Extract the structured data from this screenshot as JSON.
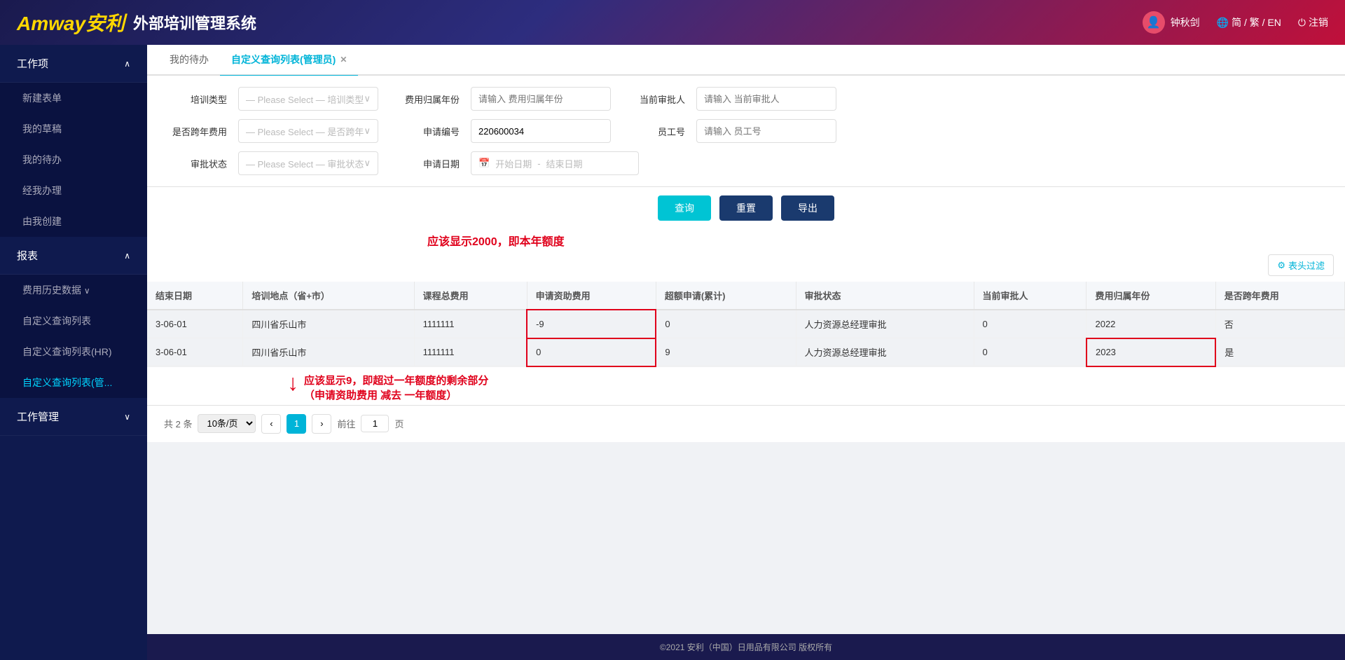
{
  "header": {
    "logo": "Amway",
    "subtitle": "安利",
    "title": "外部培训管理系统",
    "user": "钟秋剑",
    "lang": "简 / 繁 / EN",
    "logout": "注销"
  },
  "sidebar": {
    "items": [
      {
        "id": "work-items",
        "label": "工作项",
        "expanded": true,
        "children": [
          {
            "id": "new-form",
            "label": "新建表单"
          },
          {
            "id": "my-draft",
            "label": "我的草稿"
          },
          {
            "id": "my-pending",
            "label": "我的待办",
            "active": true
          },
          {
            "id": "my-done",
            "label": "经我办理"
          },
          {
            "id": "my-created",
            "label": "由我创建"
          }
        ]
      },
      {
        "id": "report",
        "label": "报表",
        "expanded": true,
        "children": [
          {
            "id": "cost-history",
            "label": "费用历史数据",
            "expanded": true
          },
          {
            "id": "custom-list",
            "label": "自定义查询列表"
          },
          {
            "id": "custom-list-hr",
            "label": "自定义查询列表(HR)"
          },
          {
            "id": "custom-list-mgr",
            "label": "自定义查询列表(管..."
          }
        ]
      },
      {
        "id": "work-mgmt",
        "label": "工作管理",
        "expanded": false
      }
    ]
  },
  "tabs": [
    {
      "id": "my-pending-tab",
      "label": "我的待办",
      "active": false,
      "closable": false
    },
    {
      "id": "custom-list-mgr-tab",
      "label": "自定义查询列表(管理员)",
      "active": true,
      "closable": true
    }
  ],
  "filters": {
    "training_type": {
      "label": "培训类型",
      "placeholder": "— Please Select — 培训类型"
    },
    "cost_year": {
      "label": "费用归属年份",
      "placeholder": "请输入 费用归属年份"
    },
    "current_approver": {
      "label": "当前审批人",
      "placeholder": "请输入 当前审批人"
    },
    "cross_year": {
      "label": "是否跨年费用",
      "placeholder": "— Please Select — 是否跨年"
    },
    "app_number": {
      "label": "申请编号",
      "value": "220600034"
    },
    "employee_id": {
      "label": "员工号",
      "placeholder": "请输入 员工号"
    },
    "approval_status": {
      "label": "审批状态",
      "placeholder": "— Please Select — 审批状态"
    },
    "app_date": {
      "label": "申请日期",
      "placeholder_start": "开始日期",
      "placeholder_end": "结束日期"
    }
  },
  "buttons": {
    "query": "查询",
    "reset": "重置",
    "export": "导出",
    "filter_cols": "表头过滤"
  },
  "annotation": {
    "top": "应该显示2000，即本年额度",
    "bottom_line1": "应该显示9，即超过一年额度的剩余部分",
    "bottom_line2": "（申请资助费用 减去 一年额度）"
  },
  "table": {
    "columns": [
      "结束日期",
      "培训地点（省+市）",
      "课程总费用",
      "申请资助费用",
      "超额申请(累计)",
      "审批状态",
      "当前审批人",
      "费用归属年份",
      "是否跨年费用"
    ],
    "rows": [
      {
        "end_date": "3-06-01",
        "location": "四川省乐山市",
        "total_cost": "1111111",
        "apply_cost": "-9",
        "overquota": "0",
        "approval_status": "人力资源总经理审批",
        "current_approver": "0",
        "cost_year": "2022",
        "cross_year": "否"
      },
      {
        "end_date": "3-06-01",
        "location": "四川省乐山市",
        "total_cost": "1111111",
        "apply_cost": "0",
        "overquota": "9",
        "approval_status": "人力资源总经理审批",
        "current_approver": "0",
        "cost_year": "2023",
        "cross_year": "是"
      }
    ]
  },
  "pagination": {
    "total_label": "共 2 条",
    "page_size": "10条/页",
    "current_page": "1",
    "prev": "<",
    "next": ">",
    "page_info_prefix": "前往"
  },
  "footer": {
    "text": "©2021 安利（中国）日用品有限公司 版权所有"
  }
}
